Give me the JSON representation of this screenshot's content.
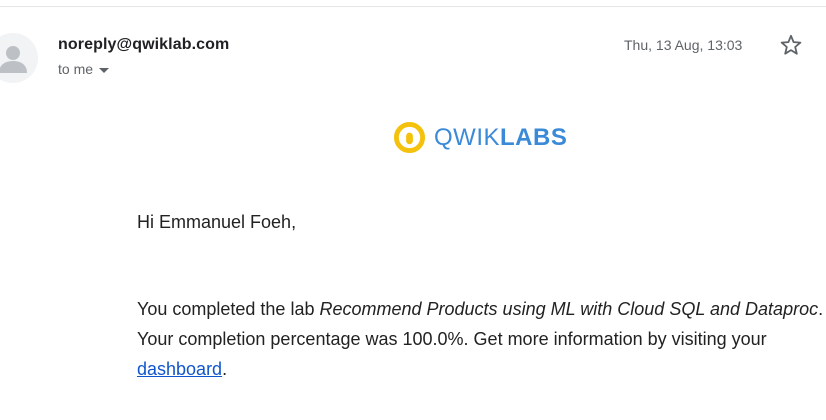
{
  "email": {
    "sender": "noreply@qwiklab.com",
    "recipient": "to me",
    "date": "Thu, 13 Aug, 13:03",
    "icons": {
      "avatar": "avatar-icon",
      "recipient_dropdown": "chevron-down-icon",
      "star": "star-icon"
    }
  },
  "logo": {
    "text_light": "QWIK",
    "text_bold": "LABS",
    "mark_color": "#f4c20d",
    "text_color": "#3b8ad8"
  },
  "message": {
    "greeting": "Hi Emmanuel Foeh,",
    "line_intro": "You completed the lab ",
    "lab_name": "Recommend Products using ML with Cloud SQL and Dataproc",
    "line_middle": ". Your completion percentage was 100.0%. Get more information by visiting your ",
    "link_text": "dashboard",
    "line_end": "."
  },
  "colors": {
    "link": "#1155cc",
    "muted": "#5f6368"
  }
}
